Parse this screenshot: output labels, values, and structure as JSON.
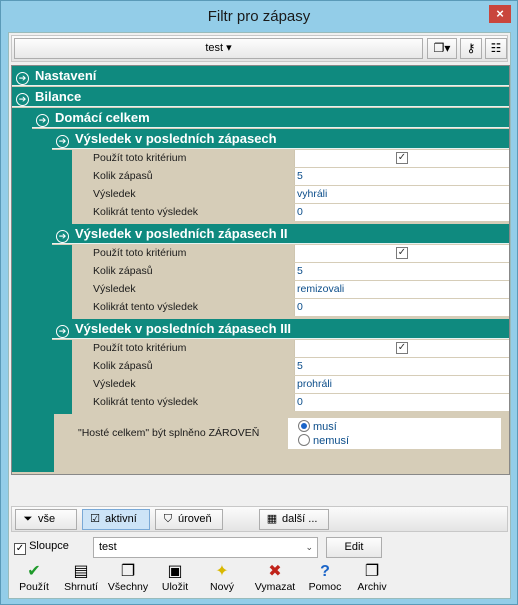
{
  "window": {
    "title": "Filtr pro zápasy",
    "close_label": "×"
  },
  "toolbar": {
    "profile_label": "test ▾"
  },
  "tree": {
    "nastaveni": "Nastavení",
    "bilance": "Bilance",
    "domaci": "Domácí celkem",
    "sections": [
      {
        "title": "Výsledek v posledních zápasech",
        "rows": [
          {
            "label": "Použít toto kritérium",
            "checked": true
          },
          {
            "label": "Kolik zápasů",
            "value": "5"
          },
          {
            "label": "Výsledek",
            "value": "vyhráli"
          },
          {
            "label": "Kolikrát tento výsledek",
            "value": "0"
          }
        ]
      },
      {
        "title": "Výsledek v posledních zápasech II",
        "rows": [
          {
            "label": "Použít toto kritérium",
            "checked": true
          },
          {
            "label": "Kolik zápasů",
            "value": "5"
          },
          {
            "label": "Výsledek",
            "value": "remizovali"
          },
          {
            "label": "Kolikrát tento výsledek",
            "value": "0"
          }
        ]
      },
      {
        "title": "Výsledek v posledních zápasech III",
        "rows": [
          {
            "label": "Použít toto kritérium",
            "checked": true
          },
          {
            "label": "Kolik zápasů",
            "value": "5"
          },
          {
            "label": "Výsledek",
            "value": "prohráli"
          },
          {
            "label": "Kolikrát tento výsledek",
            "value": "0"
          }
        ]
      }
    ],
    "and_row": {
      "label": "\"Hosté celkem\" být splněno ZÁROVEŇ",
      "option_must": "musí",
      "option_mustnot": "nemusí"
    }
  },
  "filter_bar": {
    "all": "vše",
    "active": "aktivní",
    "level": "úroveň",
    "more": "další ..."
  },
  "columns": {
    "checkbox_label": "Sloupce",
    "select_value": "test",
    "edit_label": "Edit"
  },
  "actions": [
    "Použít",
    "Shrnutí",
    "Všechny",
    "Uložit",
    "Nový",
    "Vymazat",
    "Pomoc",
    "Archiv"
  ]
}
